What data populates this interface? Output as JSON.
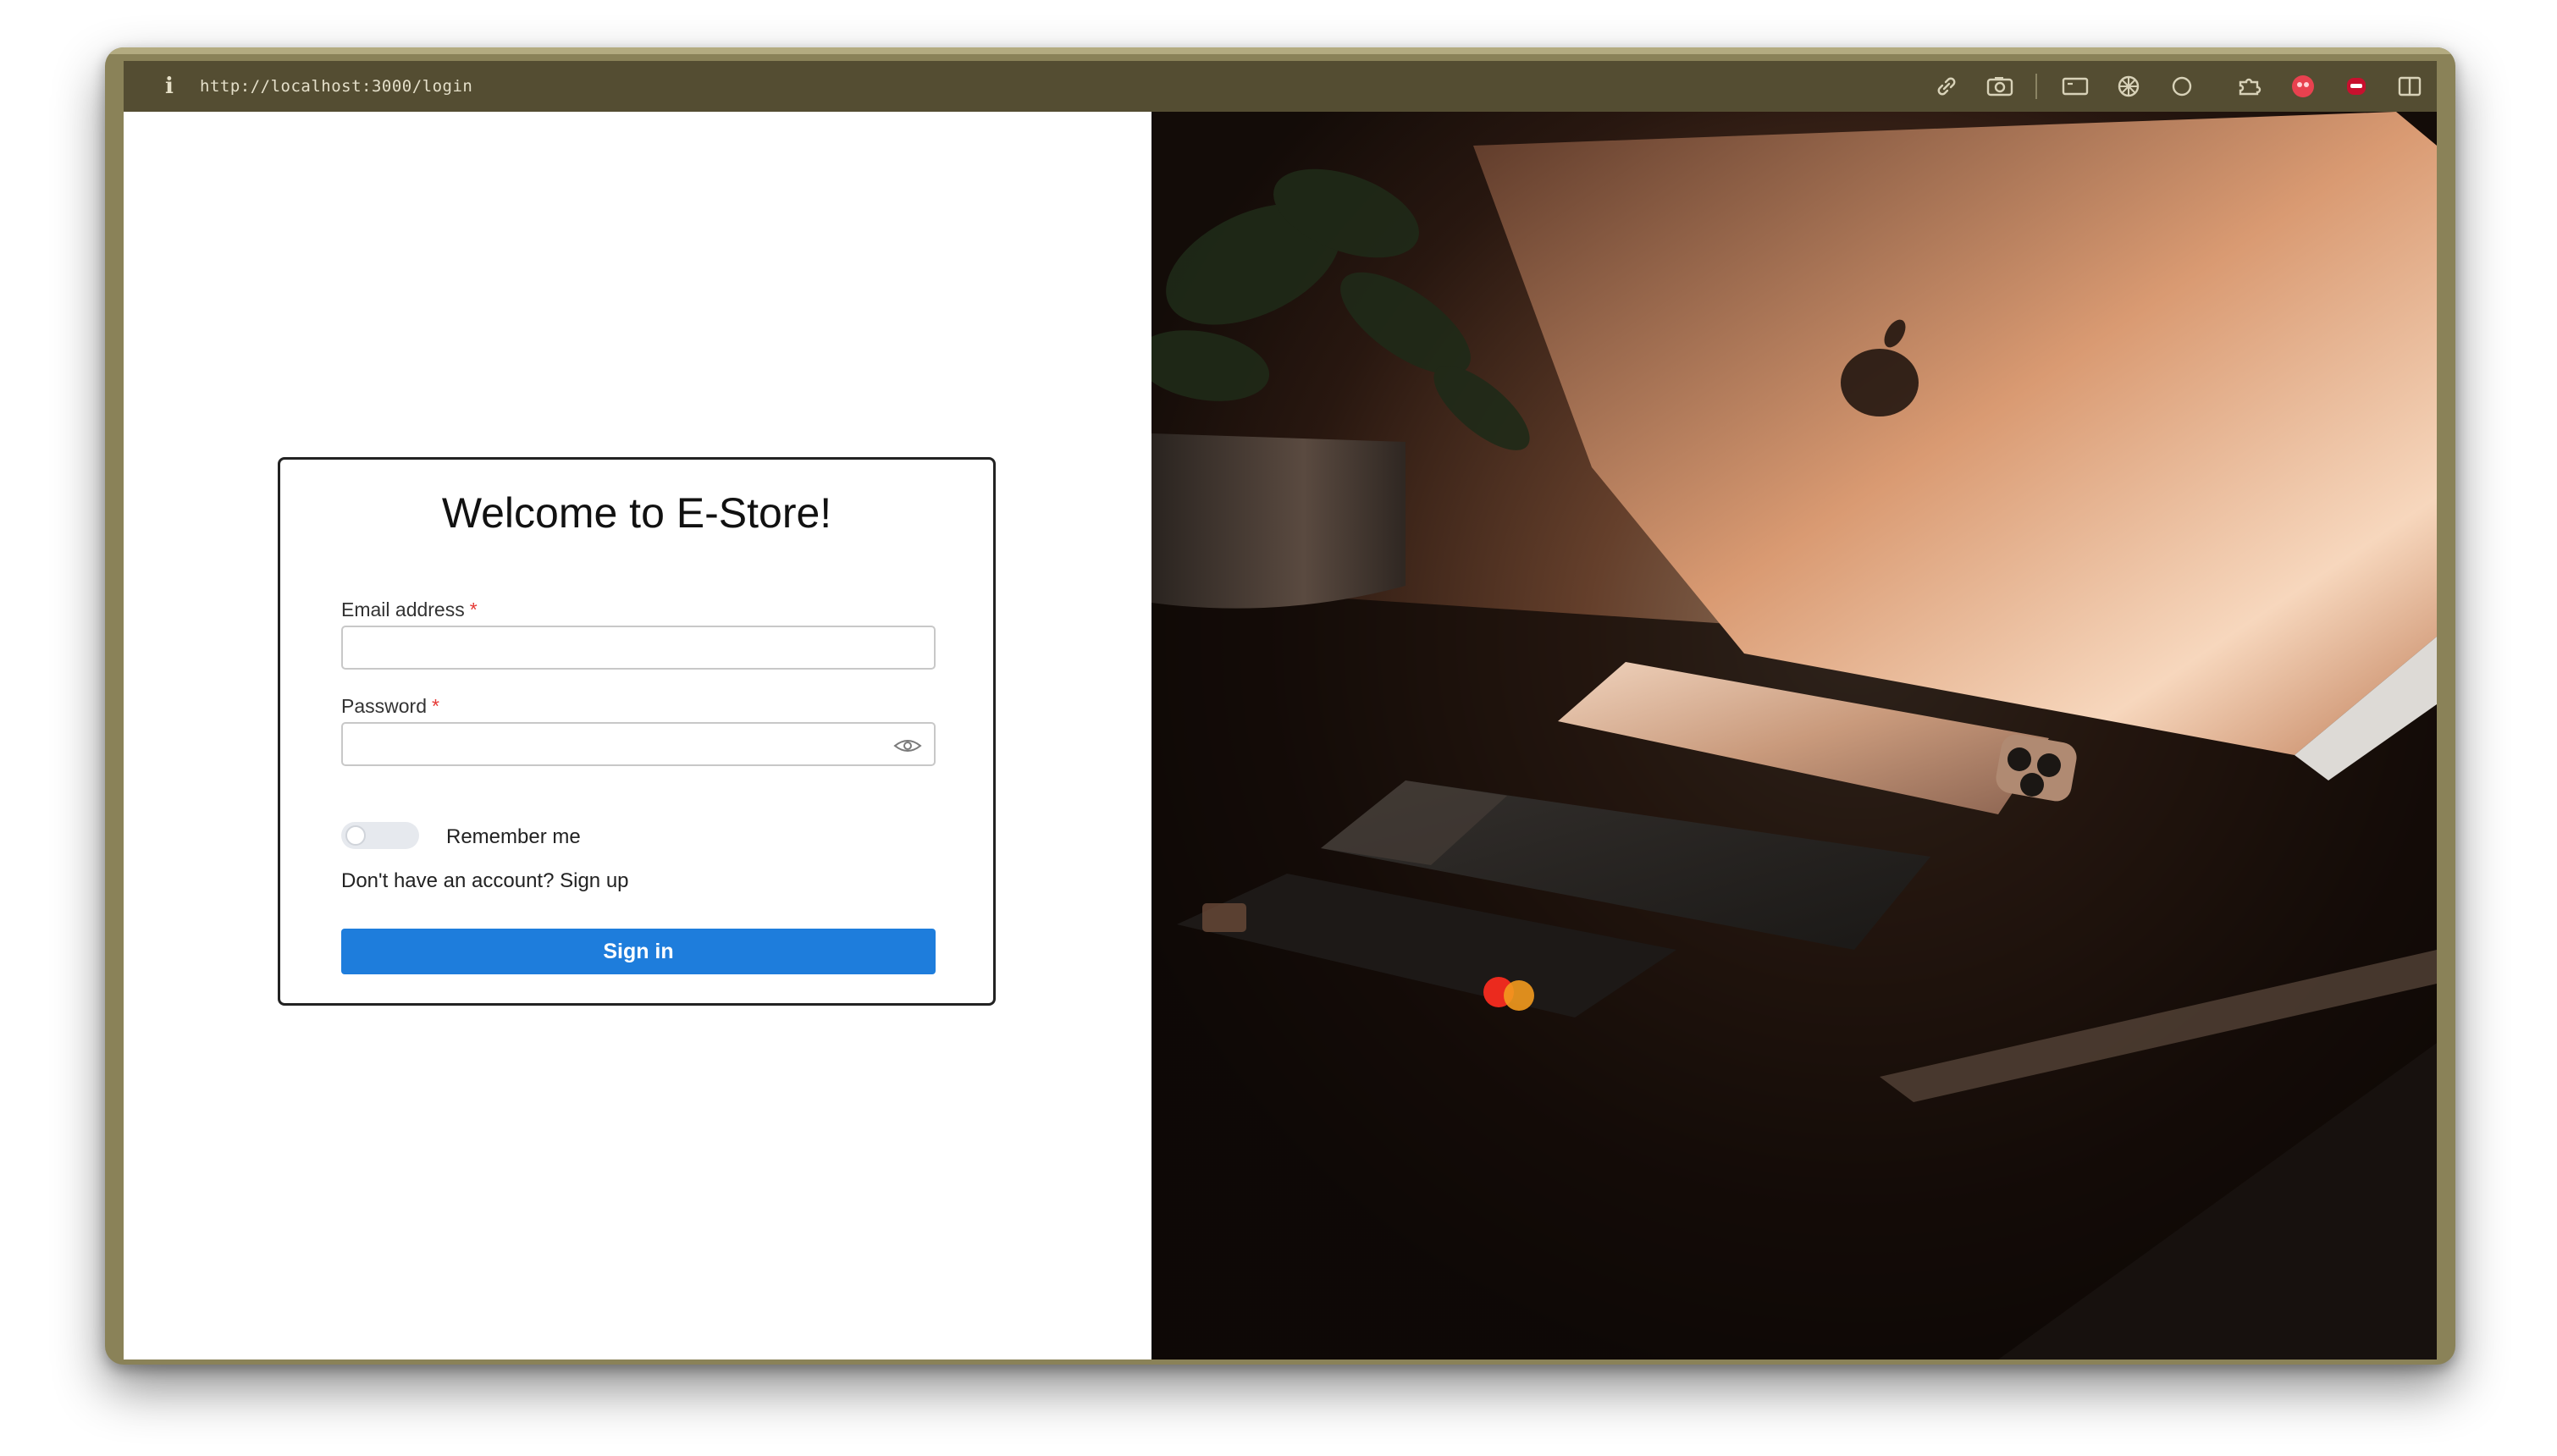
{
  "browser": {
    "url": "http://localhost:3000/login",
    "icons": [
      "info-icon",
      "link-icon",
      "screenshot-icon",
      "screen-icon",
      "print-icon",
      "circle-icon",
      "extensions-icon",
      "profile-red-icon",
      "extension-red-icon",
      "sidebar-icon"
    ],
    "accent_colors": {
      "frame": "#8a8258",
      "titlebar": "#544d32"
    }
  },
  "login": {
    "title": "Welcome to E-Store!",
    "email_label": "Email address",
    "password_label": "Password",
    "required_marker": "*",
    "remember_label": "Remember me",
    "remember_checked": false,
    "no_account_text": "Don't have an account?",
    "signup_link": "Sign up",
    "signin_label": "Sign in",
    "button_color": "#1e7ddc",
    "required_color": "#e53935"
  },
  "hero": {
    "image_subject": "laptop-phones-card-photo"
  }
}
